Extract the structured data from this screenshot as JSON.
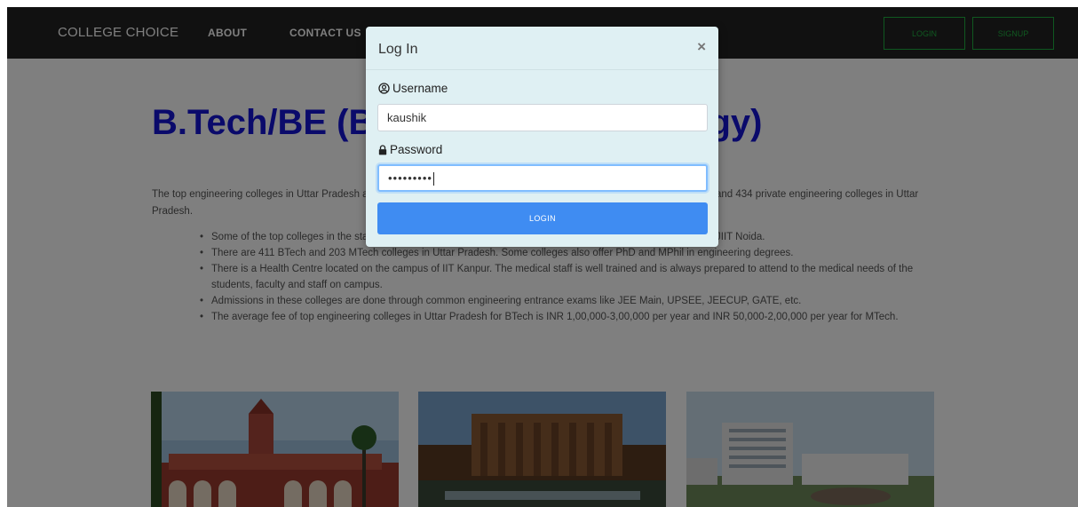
{
  "navbar": {
    "brand": "COLLEGE CHOICE",
    "links": [
      "ABOUT",
      "CONTACT US"
    ],
    "login_label": "LOGIN",
    "signup_label": "SIGNUP",
    "accent_color": "#1fb141"
  },
  "main": {
    "title": "B.Tech/BE (Bachelor of Technology)",
    "intro": "The top engineering colleges in Uttar Pradesh are ranked by NIRF, India Today, Outlook, The Week, etc. There are 27 public and 434 private engineering colleges in Uttar Pradesh.",
    "bullets": [
      "Some of the top colleges in the state are IIT Kanpur, IIT BHU, MNNIT Allahabad, Aligarh Muslim University, and JIIT Noida.",
      "There are 411 BTech and 203 MTech colleges in Uttar Pradesh. Some colleges also offer PhD and MPhil in engineering degrees.",
      "There is a Health Centre located on the campus of IIT Kanpur. The medical staff is well trained and is always prepared to attend to the medical needs of the students, faculty and staff on campus.",
      "Admissions in these colleges are done through common engineering entrance exams like JEE Main, UPSEE, JEECUP, GATE, etc.",
      "The average fee of top engineering colleges in Uttar Pradesh for BTech is INR 1,00,000-3,00,000 per year and INR 50,000-2,00,000 per year for MTech."
    ],
    "title_color": "#1515d6"
  },
  "modal": {
    "title": "Log In",
    "close_symbol": "×",
    "username_label": "Username",
    "username_value": "kaushik",
    "password_label": "Password",
    "password_value": "•••••••••",
    "login_label": "LOGIN",
    "button_color": "#3f8cf2",
    "background_color": "#dff0f3"
  },
  "icons": {
    "username": "user-circle-icon",
    "password": "lock-icon"
  }
}
